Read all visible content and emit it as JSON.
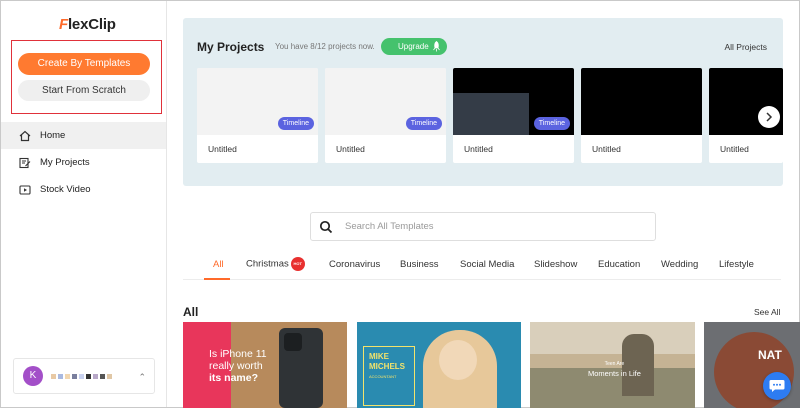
{
  "brand": {
    "logo_text": "FlexClip",
    "accent": "#ff6a2a"
  },
  "sidebar": {
    "create_by_templates": "Create By Templates",
    "start_from_scratch": "Start From Scratch",
    "items": [
      {
        "label": "Home",
        "icon": "home-icon",
        "active": true
      },
      {
        "label": "My Projects",
        "icon": "edit-icon",
        "active": false
      },
      {
        "label": "Stock Video",
        "icon": "video-icon",
        "active": false
      }
    ],
    "user": {
      "avatar_initial": "K"
    }
  },
  "projects": {
    "title": "My Projects",
    "subtitle": "You have 8/12 projects now.",
    "upgrade_label": "Upgrade",
    "all_projects_label": "All Projects",
    "cards": [
      {
        "name": "Untitled",
        "badge": "Timeline"
      },
      {
        "name": "Untitled",
        "badge": "Timeline"
      },
      {
        "name": "Untitled",
        "badge": "Timeline"
      },
      {
        "name": "Untitled",
        "badge": ""
      },
      {
        "name": "Untitled",
        "badge": ""
      }
    ]
  },
  "search": {
    "placeholder": "Search All Templates"
  },
  "tabs": [
    {
      "label": "All",
      "active": true
    },
    {
      "label": "Christmas",
      "badge": "HOT"
    },
    {
      "label": "Coronavirus"
    },
    {
      "label": "Business"
    },
    {
      "label": "Social Media"
    },
    {
      "label": "Slideshow"
    },
    {
      "label": "Education"
    },
    {
      "label": "Wedding"
    },
    {
      "label": "Lifestyle"
    }
  ],
  "section": {
    "title": "All",
    "see_all": "See All"
  },
  "templates": [
    {
      "line1": "Is iPhone 11",
      "line2": "really worth",
      "line3": "its name?"
    },
    {
      "line1": "MIKE",
      "line2": "MICHELS",
      "line3": "ACCOUNTANT"
    },
    {
      "line1": "Teen Are",
      "line2": "Moments in Life"
    },
    {
      "line1": "NAT"
    }
  ]
}
